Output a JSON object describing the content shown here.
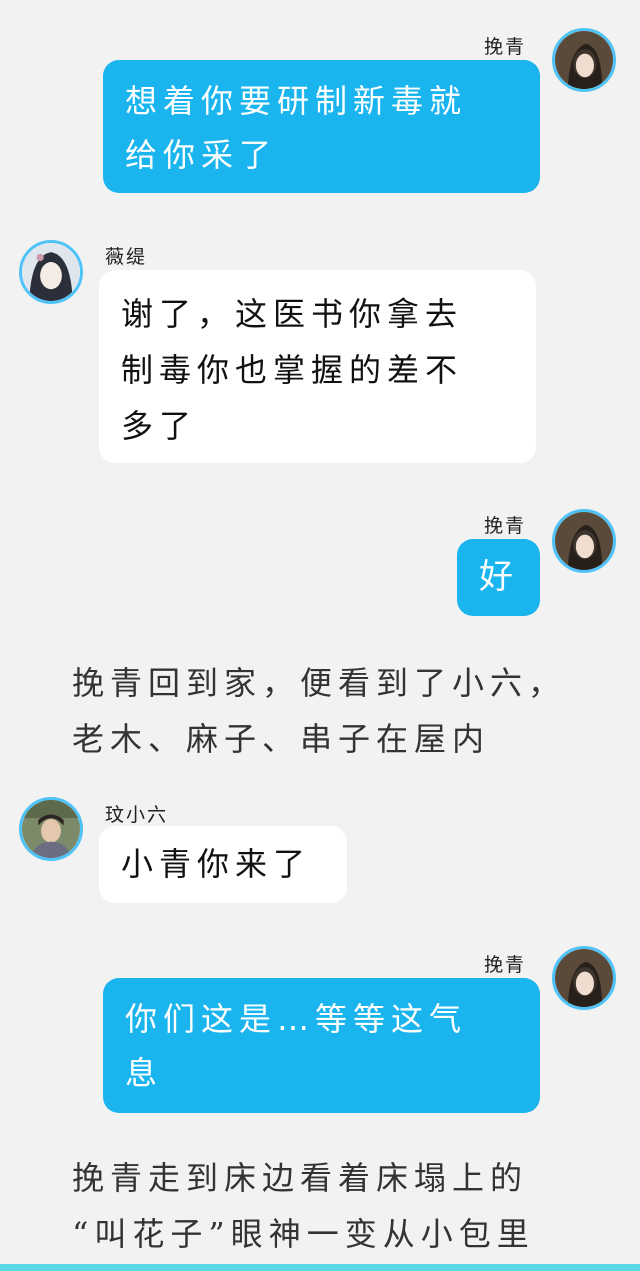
{
  "colors": {
    "background": "#f2f2f2",
    "outgoing_bubble": "#1ab4ee",
    "incoming_bubble": "#ffffff",
    "avatar_ring": "#4fc3f7",
    "bottom_bar": "#57d9e6"
  },
  "messages": [
    {
      "sender": "挽青",
      "side": "right",
      "text": "想着你要研制新毒就\n给你采了",
      "avatar_icon": "avatar-wanqing-icon"
    },
    {
      "sender": "薇缇",
      "side": "left",
      "text": "谢了，这医书你拿去\n制毒你也掌握的差不\n多了",
      "avatar_icon": "avatar-weiti-icon"
    },
    {
      "sender": "挽青",
      "side": "right",
      "text": "好",
      "avatar_icon": "avatar-wanqing-icon"
    },
    {
      "narration": "挽青回到家，便看到了小六，\n老木、麻子、串子在屋内"
    },
    {
      "sender": "玟小六",
      "side": "left",
      "text": "小青你来了",
      "avatar_icon": "avatar-xiaoliu-icon"
    },
    {
      "sender": "挽青",
      "side": "right",
      "text": "你们这是…等等这气\n息",
      "avatar_icon": "avatar-wanqing-icon"
    },
    {
      "narration": "挽青走到床边看着床塌上的\n“叫花子”眼神一变从小包里"
    }
  ]
}
